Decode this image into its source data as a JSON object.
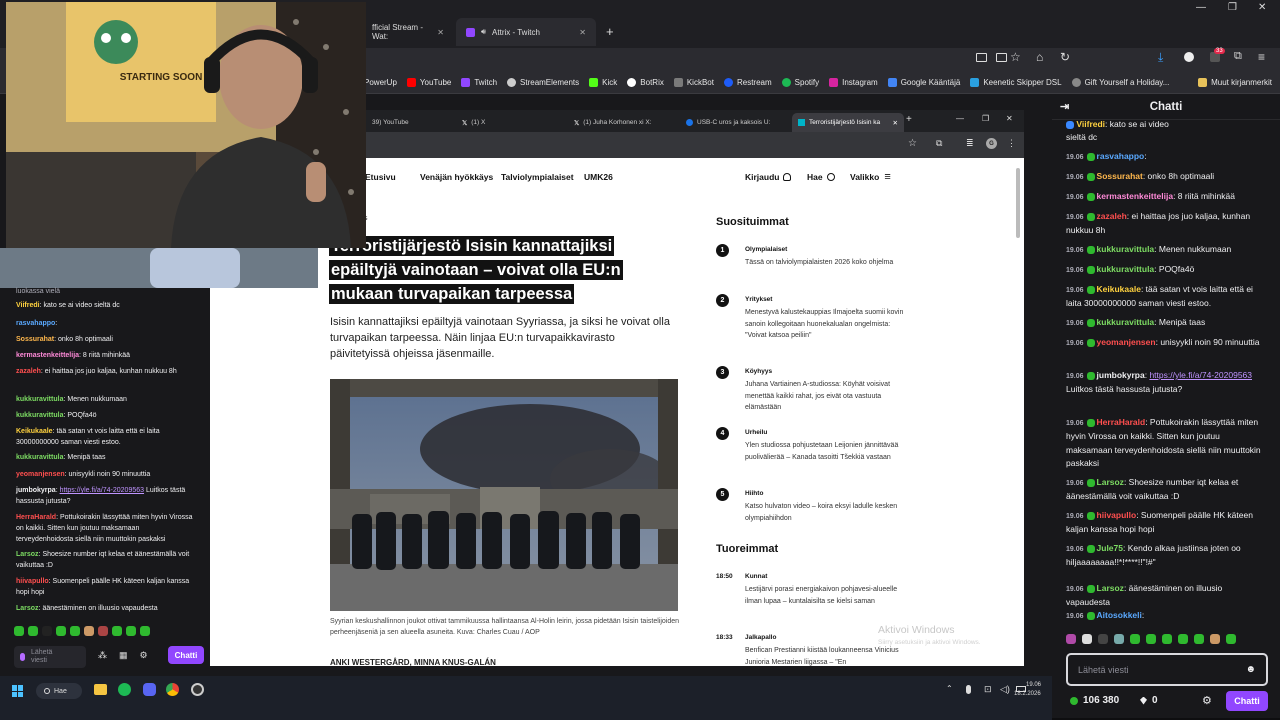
{
  "outer_browser": {
    "tabs": [
      "fficial Stream - Wat:",
      "Attrix - Twitch"
    ],
    "bookmarks": [
      "PowerUp",
      "YouTube",
      "Twitch",
      "StreamElements",
      "Kick",
      "BotRix",
      "KickBot",
      "Restream",
      "Spotify",
      "Instagram",
      "Google Kääntäjä",
      "Keenetic Skipper DSL",
      "Gift Yourself a Holiday..."
    ],
    "bookmarks_folder": "Muut kirjanmerkit",
    "extension_badge": "33"
  },
  "inner_browser": {
    "tabs": [
      "39) YouTube",
      "(1) X",
      "(1) Juha Korhonen xi X:",
      "USB-C uros ja kaksois U:",
      "Terroristijärjestö Isisin ka"
    ],
    "profile_initial": "G"
  },
  "site": {
    "nav": [
      "Etusivu",
      "Venäjän hyökkäys",
      "Talviolympialaiset",
      "UMK26"
    ],
    "login": "Kirjaudu",
    "search": "Hae",
    "menu": "Valikko",
    "section_stub": "s",
    "headline": "Terroristijärjestö Isisin kannattajiksi epäiltyjä vainotaan – voivat olla EU:n mukaan turvapaikan tarpeessa",
    "lead": "Isisin kannattajiksi epäiltyjä vainotaan Syyriassa, ja siksi he voivat olla turvapaikan tarpeessa. Näin linjaa EU:n turvapaikkavirasto päivitetyissä ohjeissa jäsenmaille.",
    "caption": "Syyrian keskushallinnon joukot ottivat tammikuussa hallintaansa Al-Holin leirin, jossa pidetään Isisin taistelijoiden perheenjäseniä ja sen alueella asuneita. Kuva: Charles Cuau / AOP",
    "authors": "ANKI WESTERGÅRD, MINNA KNUS-GALÁN",
    "popular_title": "Suosituimmat",
    "popular": [
      {
        "num": "1",
        "cat": "Olympialaiset",
        "text": "Tässä on talviolympialaisten 2026 koko ohjelma"
      },
      {
        "num": "2",
        "cat": "Yritykset",
        "text": "Menestyvä kalustekauppias Ilmajoelta suomii kovin sanoin kollegoitaan huonekalualan ongelmista: \"Voivat katsoa peiliin\""
      },
      {
        "num": "3",
        "cat": "Köyhyys",
        "text": "Juhana Vartiainen A-studiossa: Köyhät voisivat menettää kaikki rahat, jos eivät ota vastuuta elämästään"
      },
      {
        "num": "4",
        "cat": "Urheilu",
        "text": "Ylen studiossa pohjustetaan Leijonien jännittävää puolivälierää – Kanada tasoitti Tšekkiä vastaan"
      },
      {
        "num": "5",
        "cat": "Hiihto",
        "text": "Katso hulvaton video – koira eksyi ladulle kesken olympiahiihdon"
      }
    ],
    "latest_title": "Tuoreimmat",
    "latest": [
      {
        "time": "18:50",
        "cat": "Kunnat",
        "text": "Lestijärvi porasi energiakaivon pohjavesi-alueelle ilman lupaa – kuntalaisilta se kielsi saman"
      },
      {
        "time": "18:33",
        "cat": "Jalkapallo",
        "text": "Benfican Prestianni kiistää loukanneensa Vinicius Junioria Mestarien liigassa – \"En"
      }
    ],
    "watermark": "Aktivoi Windows",
    "watermark_sub": "Siirry asetuksiin ja aktivoi Windows."
  },
  "webcam": {
    "poster_text": "STARTING SOON"
  },
  "left_chat": {
    "top_stub": "luokassa vielä",
    "lines": [
      {
        "user": "Viifredi",
        "color": "#ffd23f",
        "text": ": kato se ai video sieltä dc"
      },
      {
        "user": "rasvahappo",
        "color": "#5aa9ff",
        "text": ":"
      },
      {
        "user": "Sossurahat",
        "color": "#ffb84d",
        "text": ": onko 8h optimaali"
      },
      {
        "user": "kermastenkeittelija",
        "color": "#ff8ad8",
        "text": ": 8 riitä mihinkää"
      },
      {
        "user": "zazaleh",
        "color": "#ff4f4f",
        "text": ": ei haittaa jos juo kaljaa, kunhan nukkuu 8h"
      },
      {
        "user": "kukkuravittula",
        "color": "#7ddc63",
        "text": ": Menen nukkumaan"
      },
      {
        "user": "kukkuravittula",
        "color": "#7ddc63",
        "text": ": POQfa4ö"
      },
      {
        "user": "Keikukaale",
        "color": "#ffd23f",
        "text": ": tää satan vt vois laitta että ei laita 30000000000 saman viesti estoo."
      },
      {
        "user": "kukkuravittula",
        "color": "#7ddc63",
        "text": ": Menipä taas"
      },
      {
        "user": "yeomanjensen",
        "color": "#ff4f4f",
        "text": ": unisyykli noin 90 minuuttia"
      },
      {
        "user": "jumbokyrpa",
        "color": "#efeff1",
        "text": ": ",
        "link": "https://yle.fi/a/74-20209563",
        "after": " Luitkos tästä hassusta jutusta?"
      },
      {
        "user": "HerraHarald",
        "color": "#ff4f4f",
        "text": ": Pottukoirakin lässyttää miten hyvin Virossa on kaikki. Sitten kun joutuu maksamaan terveydenhoidosta siellä niin muuttokin paskaksi"
      },
      {
        "user": "Larsoz",
        "color": "#7ddc63",
        "text": ": Shoesize number iqt kelaa et äänestämällä voit vaikuttaa :D"
      },
      {
        "user": "hiivapullo",
        "color": "#ff4f4f",
        "text": ": Suomenpeli päälle HK käteen kaljan kanssa hopi hopi"
      },
      {
        "user": "Larsoz",
        "color": "#7ddc63",
        "text": ": äänestäminen on illuusio vapaudesta"
      }
    ],
    "input_placeholder": "Lähetä viesti",
    "chat_button": "Chatti"
  },
  "right_chat": {
    "title": "Chatti",
    "top_stub": {
      "user": "Viifredi",
      "text": ": kato se ai video",
      "line2": "sieltä dc"
    },
    "lines": [
      {
        "ts": "19.06",
        "user": "rasvahappo",
        "color": "#5aa9ff",
        "text": ":"
      },
      {
        "ts": "19.06",
        "user": "Sossurahat",
        "color": "#ffb84d",
        "text": ": onko 8h optimaali"
      },
      {
        "ts": "19.06",
        "user": "kermastenkeittelija",
        "color": "#ff8ad8",
        "text": ": 8 riitä mihinkää"
      },
      {
        "ts": "19.06",
        "user": "zazaleh",
        "color": "#ff4f4f",
        "text": ": ei haittaa jos juo kaljaa, kunhan nukkuu 8h"
      },
      {
        "ts": "19.06",
        "user": "kukkuravittula",
        "color": "#7ddc63",
        "text": ": Menen nukkumaan"
      },
      {
        "ts": "19.06",
        "user": "kukkuravittula",
        "color": "#7ddc63",
        "text": ": POQfa4ö"
      },
      {
        "ts": "19.06",
        "user": "Keikukaale",
        "color": "#ffd23f",
        "text": ": tää satan vt vois laitta että ei laita 30000000000 saman viesti estoo."
      },
      {
        "ts": "19.06",
        "user": "kukkuravittula",
        "color": "#7ddc63",
        "text": ": Menipä taas"
      },
      {
        "ts": "19.06",
        "user": "yeomanjensen",
        "color": "#ff4f4f",
        "text": ": unisyykli noin 90 minuuttia"
      },
      {
        "ts": "19.06",
        "user": "jumbokyrpa",
        "color": "#efeff1",
        "text": ": ",
        "link": "https://yle.fi/a/74-20209563",
        "after": " Luitkos tästä hassusta jutusta?"
      },
      {
        "ts": "19.06",
        "user": "HerraHarald",
        "color": "#ff4f4f",
        "text": ": Pottukoirakin lässyttää miten hyvin Virossa on kaikki. Sitten kun joutuu maksamaan terveydenhoidosta siellä niin muuttokin paskaksi"
      },
      {
        "ts": "19.06",
        "user": "Larsoz",
        "color": "#7ddc63",
        "text": ": Shoesize number iqt kelaa et äänestämällä voit vaikuttaa :D"
      },
      {
        "ts": "19.06",
        "user": "hiivapullo",
        "color": "#ff4f4f",
        "text": ": Suomenpeli päälle HK käteen kaljan kanssa hopi hopi"
      },
      {
        "ts": "19.06",
        "user": "Jule75",
        "color": "#7ddc63",
        "text": ": Kendo alkaa justiinsa joten oo hiljaaaaaaaa!!*!****!!\"!#\""
      },
      {
        "ts": "19.06",
        "user": "Larsoz",
        "color": "#7ddc63",
        "text": ": äänestäminen on illuusio vapaudesta"
      },
      {
        "ts": "19.06",
        "user": "Aitosokkeli",
        "color": "#5aa9ff",
        "text": ":"
      }
    ],
    "input_placeholder": "Lähetä viesti",
    "points": "106 380",
    "bits": "0",
    "chat_button": "Chatti"
  },
  "taskbar": {
    "search": "Hae",
    "time": "19.06",
    "date": "18.2.2026"
  },
  "colors": {
    "twitch_purple": "#9147ff",
    "chat_bg": "#18181b",
    "taskbar_bg": "#1c2029"
  }
}
